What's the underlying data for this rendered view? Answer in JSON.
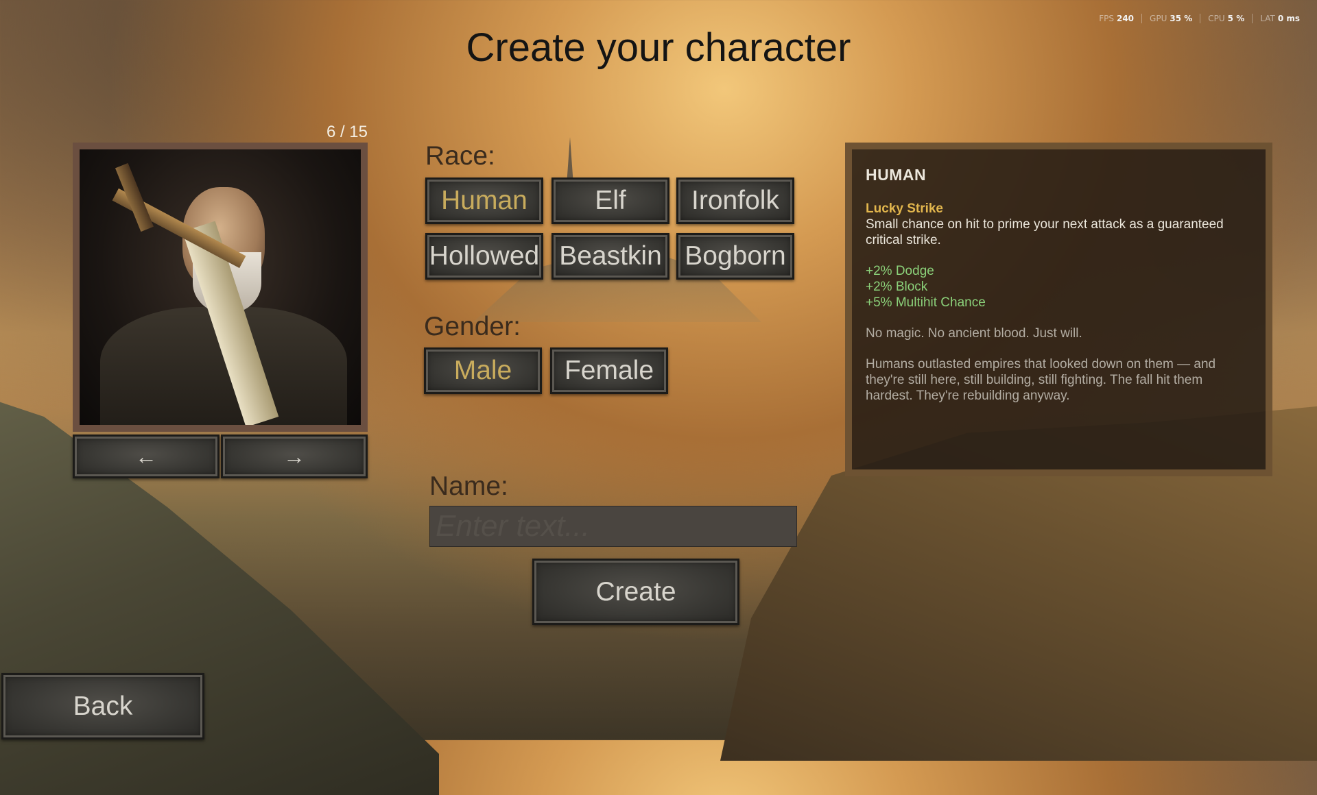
{
  "title": "Create your character",
  "perf_stats": [
    {
      "key": "FPS",
      "value": "240"
    },
    {
      "key": "GPU",
      "value": "35 %"
    },
    {
      "key": "CPU",
      "value": "5 %"
    },
    {
      "key": "LAT",
      "value": "0 ms"
    }
  ],
  "portrait": {
    "counter": "6 / 15",
    "prev_label": "←",
    "next_label": "→"
  },
  "race": {
    "label": "Race:",
    "options": [
      "Human",
      "Elf",
      "Ironfolk",
      "Hollowed",
      "Beastkin",
      "Bogborn"
    ],
    "selected": "Human"
  },
  "gender": {
    "label": "Gender:",
    "options": [
      "Male",
      "Female"
    ],
    "selected": "Male"
  },
  "name": {
    "label": "Name:",
    "placeholder": "Enter text...",
    "value": ""
  },
  "buttons": {
    "create": "Create",
    "back": "Back"
  },
  "info": {
    "title": "HUMAN",
    "trait_name": "Lucky Strike",
    "trait_desc": "Small chance on hit to prime your next attack as a guaranteed critical strike.",
    "bonuses": [
      "+2% Dodge",
      "+2% Block",
      "+5% Multihit Chance"
    ],
    "tagline": "No magic. No ancient blood. Just will.",
    "lore": "Humans outlasted empires that looked down on them — and they're still here, still building, still fighting. The fall hit them hardest. They're rebuilding anyway."
  },
  "colors": {
    "selected_text": "#c9ac5d",
    "bonus_text": "#8bd17a",
    "trait_text": "#e2b64d"
  }
}
